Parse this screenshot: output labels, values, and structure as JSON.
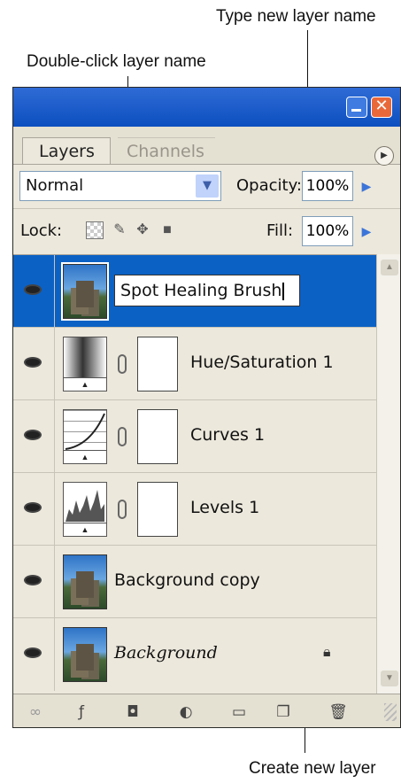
{
  "callouts": {
    "type_new": "Type new layer name",
    "double_click": "Double-click layer name",
    "create_new": "Create new layer"
  },
  "panel": {
    "tabs": [
      "Layers",
      "Channels"
    ],
    "blend_mode": "Normal",
    "opacity_label": "Opacity:",
    "opacity_value": "100%",
    "lock_label": "Lock:",
    "fill_label": "Fill:",
    "fill_value": "100%"
  },
  "layers": [
    {
      "name": "Spot Healing Brush",
      "kind": "photo",
      "selected": true,
      "editing": true
    },
    {
      "name": "Hue/Saturation 1",
      "kind": "adjustment-hue"
    },
    {
      "name": "Curves 1",
      "kind": "adjustment-curves"
    },
    {
      "name": "Levels 1",
      "kind": "adjustment-levels"
    },
    {
      "name": "Background copy",
      "kind": "photo"
    },
    {
      "name": "Background",
      "kind": "photo",
      "locked": true,
      "italic": true
    }
  ],
  "colors": {
    "selection": "#0b61c4",
    "titlebar": "#0c4fbf",
    "panel": "#ece8dc"
  }
}
